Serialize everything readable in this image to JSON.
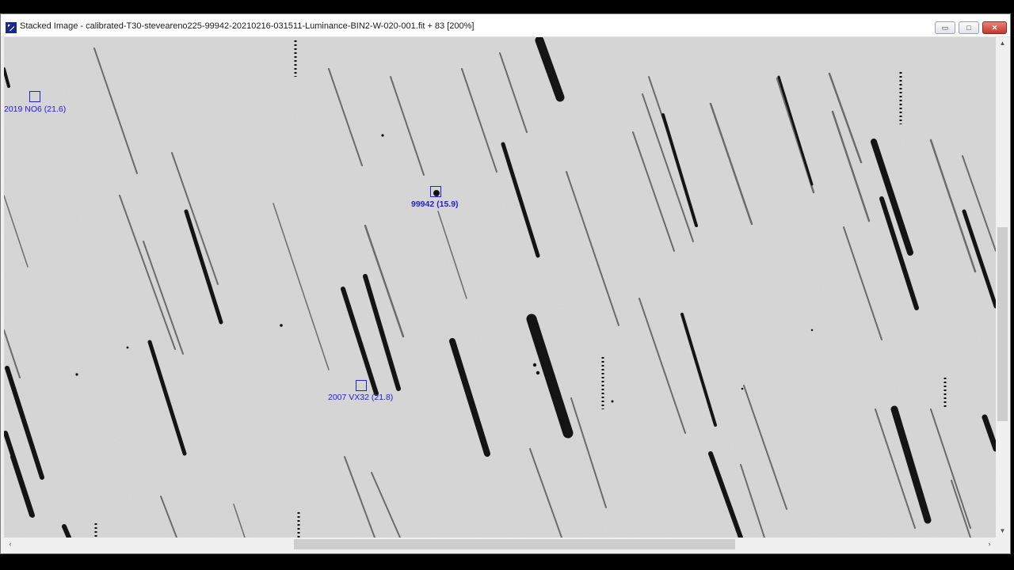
{
  "window": {
    "title": "Stacked Image - calibrated-T30-steveareno225-99942-20210216-031511-Luminance-BIN2-W-020-001.fit + 83 [200%]",
    "minimize_glyph": "▭",
    "maximize_glyph": "□",
    "close_glyph": "✕"
  },
  "annotations": [
    {
      "label": "2019 NO6 (21.6)",
      "bold": false
    },
    {
      "label": "99942 (15.9)",
      "bold": true
    },
    {
      "label": "2007 VX32 (21.8)",
      "bold": false
    }
  ],
  "scrollbars": {
    "up_arrow": "▲",
    "down_arrow": "▼",
    "left_arrow": "‹",
    "right_arrow": "›"
  },
  "colors": {
    "annotation": "#2222cc",
    "sky_background": "#d9d9d9",
    "star_trail": "#111111"
  }
}
